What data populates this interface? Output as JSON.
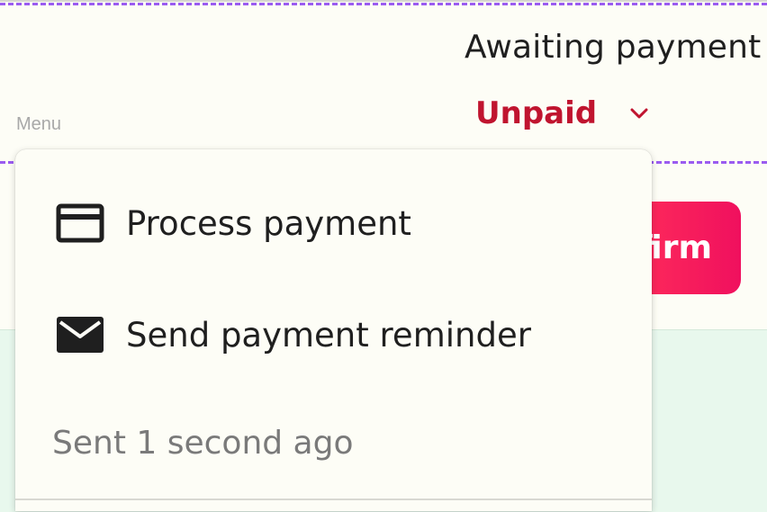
{
  "order_status": {
    "title": "Awaiting payment",
    "selected": "Unpaid",
    "chevron_icon": "chevron-down-icon",
    "selected_color": "#c0142f"
  },
  "menu": {
    "caption": "Menu",
    "items": [
      {
        "label": "Process payment",
        "icon": "credit-card-icon"
      },
      {
        "label": "Send payment reminder",
        "icon": "envelope-icon"
      }
    ],
    "sent_note": "Sent 1 second ago"
  },
  "actions": {
    "confirm_label": "Confirm",
    "confirm_color": "#f0105e"
  },
  "colors": {
    "background": "#fdfdf6",
    "dashed_guide": "#9b5cf0",
    "panel_green": "#e8f8ed"
  }
}
